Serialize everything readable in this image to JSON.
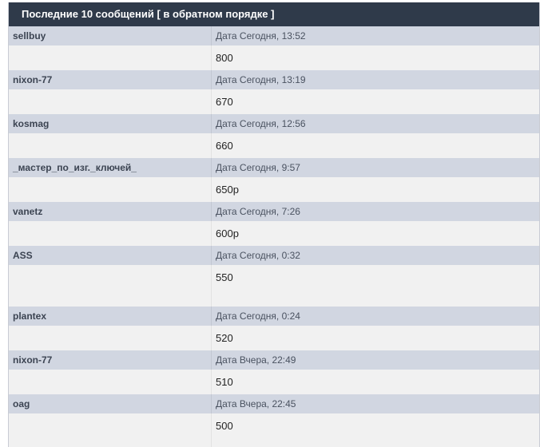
{
  "header": {
    "title": "Последние 10 сообщений [ в обратном порядке ]"
  },
  "posts": [
    {
      "author": "sellbuy",
      "date": "Дата Сегодня, 13:52",
      "message": "800"
    },
    {
      "author": "nixon-77",
      "date": "Дата Сегодня, 13:19",
      "message": "670"
    },
    {
      "author": "kosmag",
      "date": "Дата Сегодня, 12:56",
      "message": "660"
    },
    {
      "author": "_мастер_по_изг._ключей_",
      "date": "Дата Сегодня, 9:57",
      "message": "650р"
    },
    {
      "author": "vanetz",
      "date": "Дата Сегодня, 7:26",
      "message": "600р"
    },
    {
      "author": "ASS",
      "date": "Дата Сегодня, 0:32",
      "message": "550"
    },
    {
      "author": "plantex",
      "date": "Дата Сегодня, 0:24",
      "message": "520"
    },
    {
      "author": "nixon-77",
      "date": "Дата Вчера, 22:49",
      "message": "510"
    },
    {
      "author": "oag",
      "date": "Дата Вчера, 22:45",
      "message": "500"
    }
  ]
}
